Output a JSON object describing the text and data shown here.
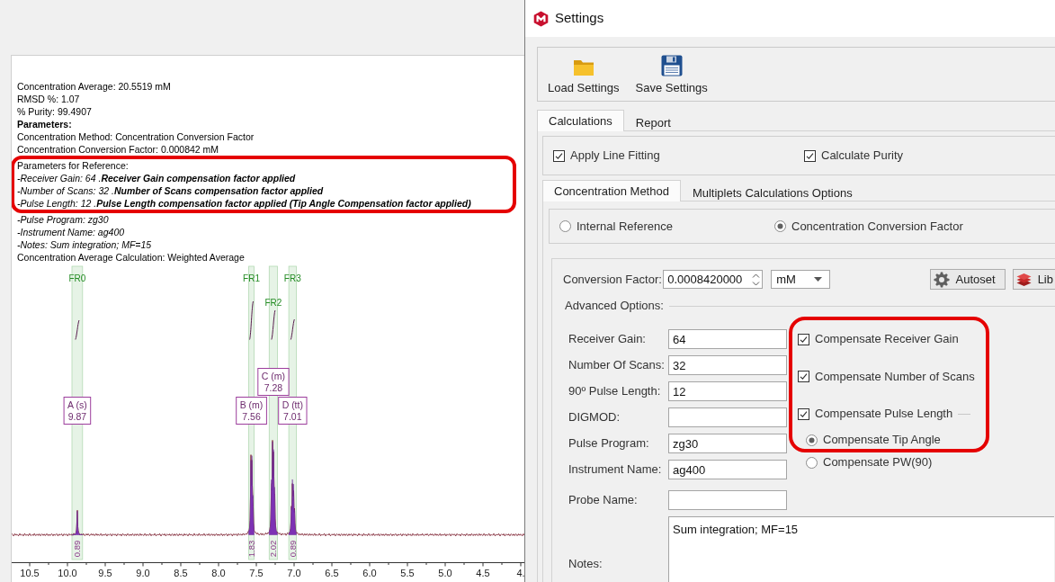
{
  "report": {
    "lines": [
      {
        "kind": "plain",
        "text": "Concentration Average: 20.5519 mM",
        "highlighted": false
      },
      {
        "kind": "plain",
        "text": "RMSD %: 1.07",
        "highlighted": false
      },
      {
        "kind": "plain",
        "text": "% Purity: 99.4907",
        "highlighted": false
      },
      {
        "kind": "heading",
        "text": "Parameters:",
        "highlighted": false
      },
      {
        "kind": "plain",
        "text": "Concentration Method: Concentration Conversion Factor",
        "highlighted": false
      },
      {
        "kind": "plain",
        "text": "Concentration Conversion Factor: 0.000842 mM",
        "highlighted": false
      },
      {
        "kind": "plain",
        "text": "Parameters for Reference:",
        "highlighted": true
      },
      {
        "kind": "italic",
        "text": "-Receiver Gain: 64 .**Receiver Gain compensation factor applied**",
        "highlighted": true
      },
      {
        "kind": "italic",
        "text": "-Number of Scans: 32 .**Number of Scans compensation factor applied**",
        "highlighted": true
      },
      {
        "kind": "italic",
        "text": "-Pulse Length: 12 .**Pulse Length compensation factor applied (Tip Angle Compensation factor applied)**",
        "highlighted": true
      },
      {
        "kind": "italic",
        "text": "-Pulse Program: zg30",
        "highlighted": false
      },
      {
        "kind": "italic",
        "text": "-Instrument Name: ag400",
        "highlighted": false
      },
      {
        "kind": "italic",
        "text": "-Notes: Sum integration; MF=15",
        "highlighted": false
      },
      {
        "kind": "plain",
        "text": "Concentration Average Calculation: Weighted Average",
        "highlighted": false
      }
    ]
  },
  "spectrum": {
    "x_ticks": [
      "10.5",
      "10.0",
      "9.5",
      "9.0",
      "8.5",
      "8.0",
      "7.5",
      "7.0",
      "6.5",
      "6.0",
      "5.5",
      "5.0",
      "4.5",
      "4."
    ],
    "peaks": [
      {
        "range": "FR0",
        "multiplet": "A (s)",
        "shift": "9.87",
        "integral": "0.89"
      },
      {
        "range": "FR1",
        "multiplet": "B (m)",
        "shift": "7.56",
        "integral": "1.83"
      },
      {
        "range": "FR2",
        "multiplet": "C (m)",
        "shift": "7.28",
        "integral": "2.02"
      },
      {
        "range": "FR3",
        "multiplet": "D (tt)",
        "shift": "7.01",
        "integral": "0.89"
      }
    ]
  },
  "dialog": {
    "title": "Settings",
    "toolbar": [
      {
        "label": "Load Settings"
      },
      {
        "label": "Save Settings"
      }
    ],
    "tabs": [
      {
        "label": "Calculations",
        "selected": true
      },
      {
        "label": "Report",
        "selected": false
      }
    ],
    "options": [
      {
        "label": "Apply Line Fitting",
        "checked": true
      },
      {
        "label": "Calculate Purity",
        "checked": true
      }
    ],
    "method_tabs": [
      {
        "label": "Concentration Method",
        "selected": true
      },
      {
        "label": "Multiplets Calculations Options",
        "selected": false
      }
    ],
    "method": [
      {
        "label": "Internal Reference",
        "selected": false
      },
      {
        "label": "Concentration Conversion Factor",
        "selected": true
      }
    ],
    "conversion_factor": {
      "label": "Conversion Factor:",
      "value": "0.0008420000",
      "unit": "mM"
    },
    "buttons": [
      {
        "label": "Autoset"
      },
      {
        "label": "Lib"
      }
    ],
    "advanced_options": {
      "title": "Advanced Options:",
      "fields": [
        {
          "label": "Receiver Gain:",
          "value": "64"
        },
        {
          "label": "Number Of Scans:",
          "value": "32"
        },
        {
          "label": "90º Pulse Length:",
          "value": "12"
        },
        {
          "label": "DIGMOD:"
        },
        {
          "label": "Pulse Program:",
          "value": "zg30"
        },
        {
          "label": "Instrument Name:",
          "value": "ag400"
        },
        {
          "label": "Probe Name:"
        }
      ],
      "compensation": [
        {
          "kind": "checkbox",
          "label": "Compensate Receiver Gain",
          "checked": true,
          "highlighted": true
        },
        {
          "kind": "checkbox",
          "label": "Compensate Number of Scans",
          "checked": true,
          "highlighted": true
        },
        {
          "kind": "checkbox",
          "label": "Compensate Pulse Length",
          "checked": true,
          "highlighted": true
        },
        {
          "kind": "radio",
          "label": "Compensate Tip Angle",
          "selected": true,
          "highlighted": true
        },
        {
          "kind": "radio",
          "label": "Compensate PW(90)",
          "selected": false,
          "highlighted": false
        }
      ]
    },
    "notes": {
      "label": "Notes:",
      "value": "Sum integration; MF=15"
    }
  }
}
